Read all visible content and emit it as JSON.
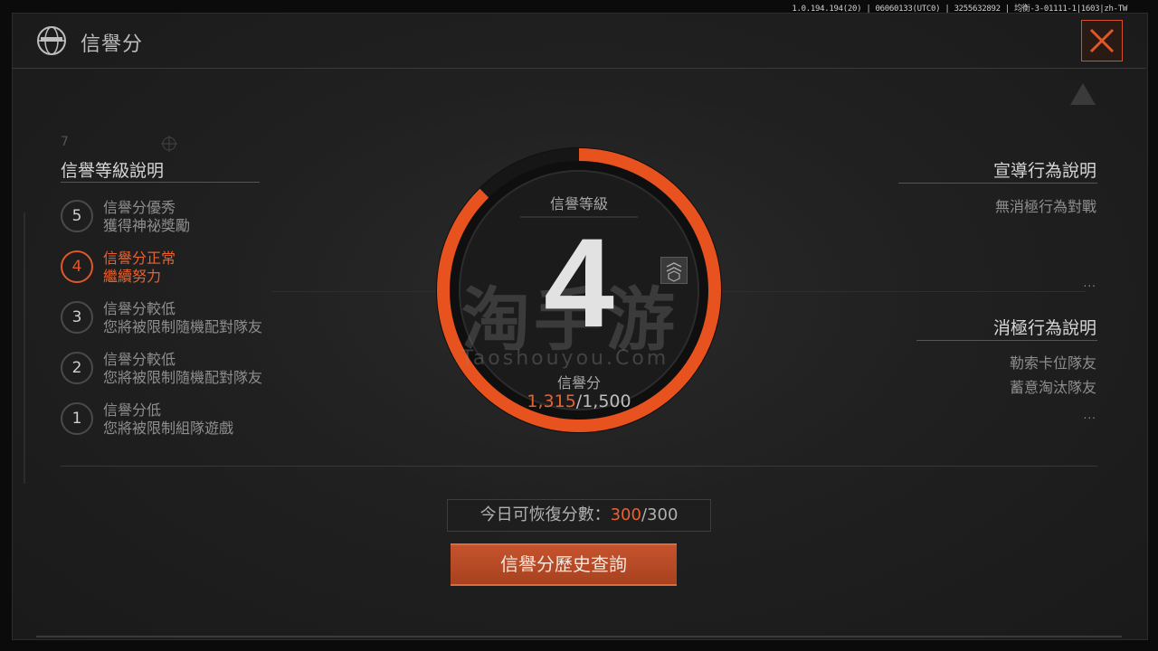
{
  "build_info": "1.0.194.194(20) | 06060133(UTC0) | 3255632892 | 均衡-3-01111-1|1603|zh-TW",
  "header": {
    "title": "信譽分"
  },
  "left_panel": {
    "title": "信譽等級說明",
    "levels": [
      {
        "num": "5",
        "line1": "信譽分優秀",
        "line2": "獲得神祕獎勵",
        "active": false
      },
      {
        "num": "4",
        "line1": "信譽分正常",
        "line2": "繼續努力",
        "active": true
      },
      {
        "num": "3",
        "line1": "信譽分較低",
        "line2": "您將被限制隨機配對隊友",
        "active": false
      },
      {
        "num": "2",
        "line1": "信譽分較低",
        "line2": "您將被限制隨機配對隊友",
        "active": false
      },
      {
        "num": "1",
        "line1": "信譽分低",
        "line2": "您將被限制組隊遊戲",
        "active": false
      }
    ]
  },
  "gauge": {
    "label": "信譽等級",
    "level": "4",
    "score_label": "信譽分",
    "score_current": "1,315",
    "score_max": "/1,500",
    "score_value": 1315,
    "score_total": 1500
  },
  "watermark": {
    "cn": "淘手游",
    "en": "Taoshouyou.Com"
  },
  "right_panel": {
    "promote_title": "宣導行為說明",
    "promote_items": [
      "無消極行為對戰"
    ],
    "negative_title": "消極行為說明",
    "negative_items": [
      "勒索卡位隊友",
      "蓄意淘汰隊友"
    ],
    "more": "..."
  },
  "recover": {
    "label": "今日可恢復分數：",
    "current": "300",
    "max": "/300"
  },
  "history_button": "信譽分歷史查詢",
  "colors": {
    "accent": "#e8622f",
    "panel": "#222222"
  }
}
